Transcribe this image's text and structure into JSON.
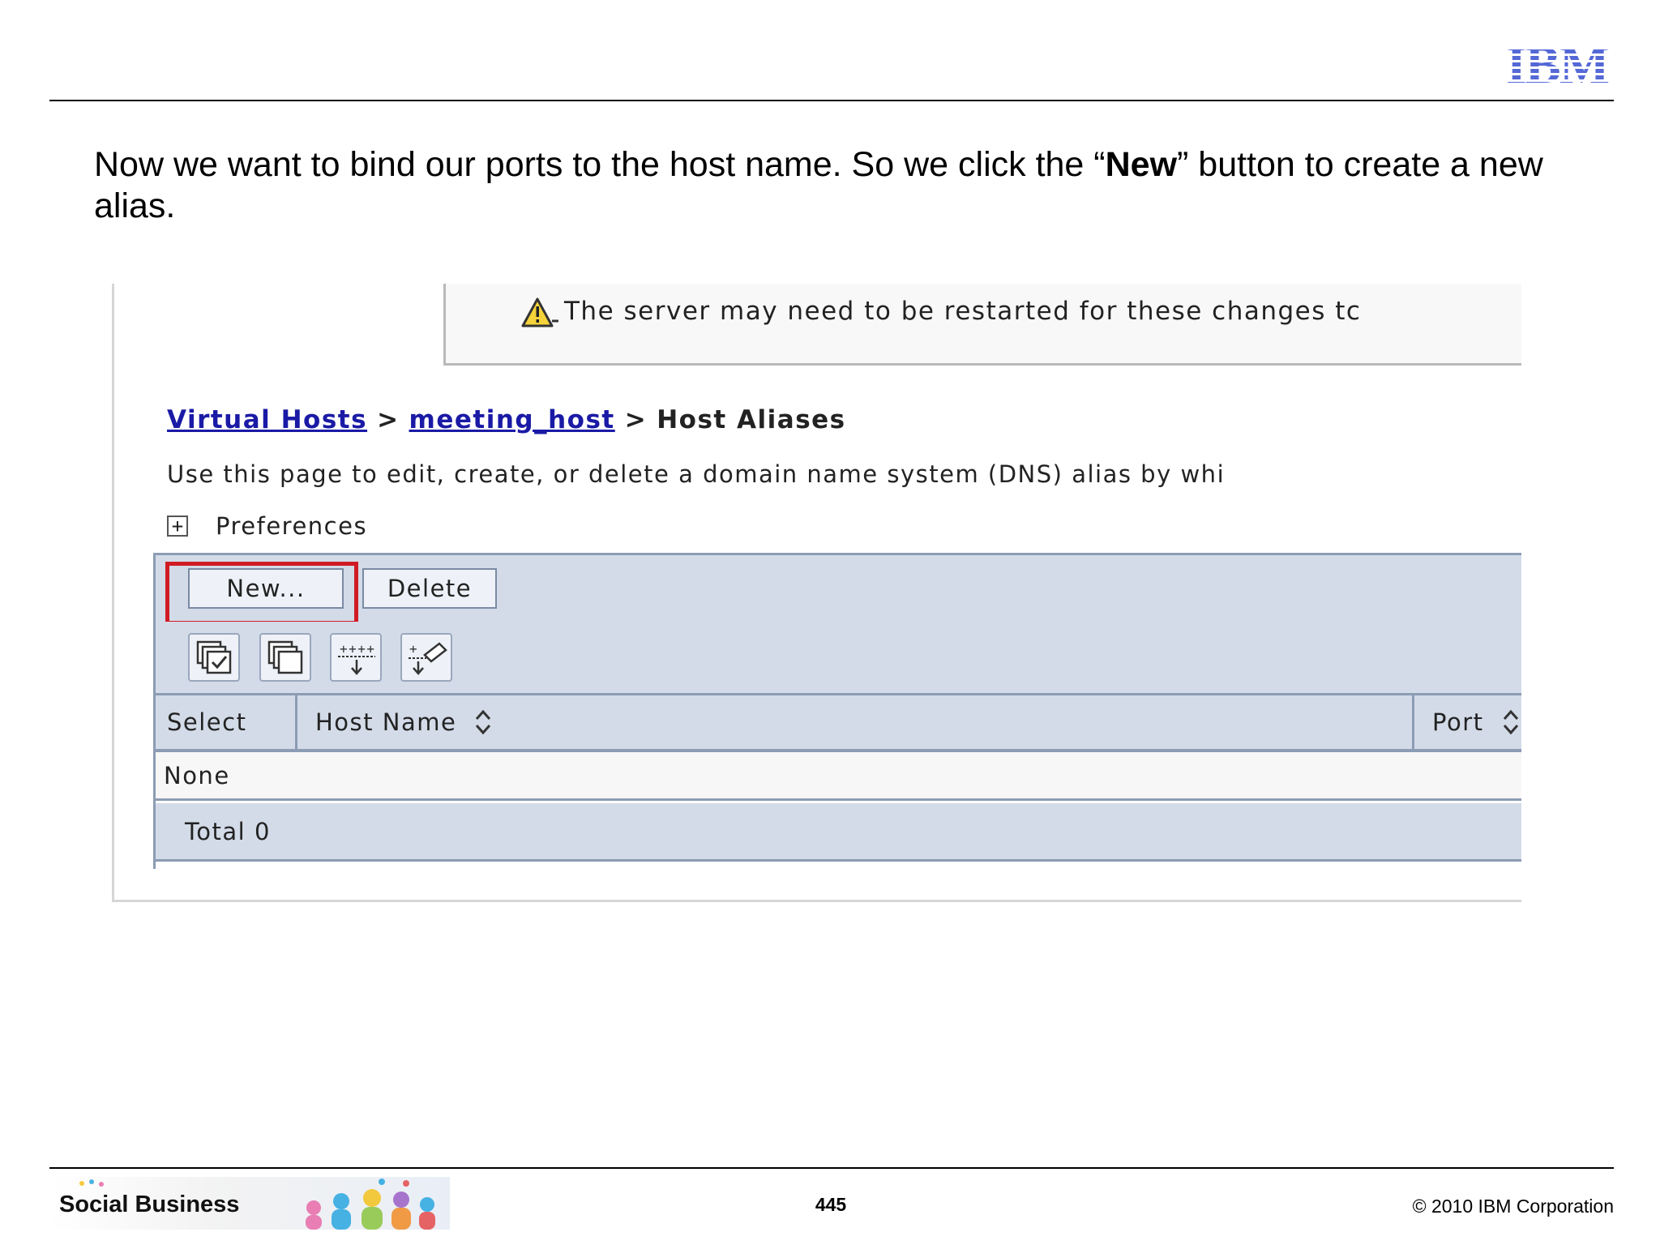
{
  "slide": {
    "caption_before": "Now we want to bind our ports to the host name. So we click the “",
    "caption_bold": "New",
    "caption_after": "” button to create a new alias.",
    "logo": "IBM",
    "footer_brand": "Social Business",
    "page_number": "445",
    "copyright": "© 2010 IBM Corporation"
  },
  "screenshot": {
    "warning": {
      "icon": "warning-triangle-icon",
      "text": "The server may need to be restarted for these changes tc"
    },
    "breadcrumb": {
      "link1": "Virtual Hosts",
      "sep": ">",
      "link2": "meeting_host",
      "current": "Host Aliases"
    },
    "description": "Use this page to edit, create, or delete a domain name system (DNS) alias by whi",
    "preferences_label": "Preferences",
    "buttons": {
      "new": "New...",
      "delete": "Delete"
    },
    "toolbar_icons": [
      "select-all-icon",
      "deselect-all-icon",
      "show-filter-icon",
      "clear-filter-icon"
    ],
    "table": {
      "columns": [
        "Select",
        "Host Name",
        "Port"
      ],
      "empty_text": "None",
      "total": "Total 0"
    },
    "colors": {
      "highlight": "#d11b24",
      "link": "#1a1aa6",
      "table_band": "#d3dbe8",
      "ibm_blue": "#4a5fd6"
    }
  }
}
